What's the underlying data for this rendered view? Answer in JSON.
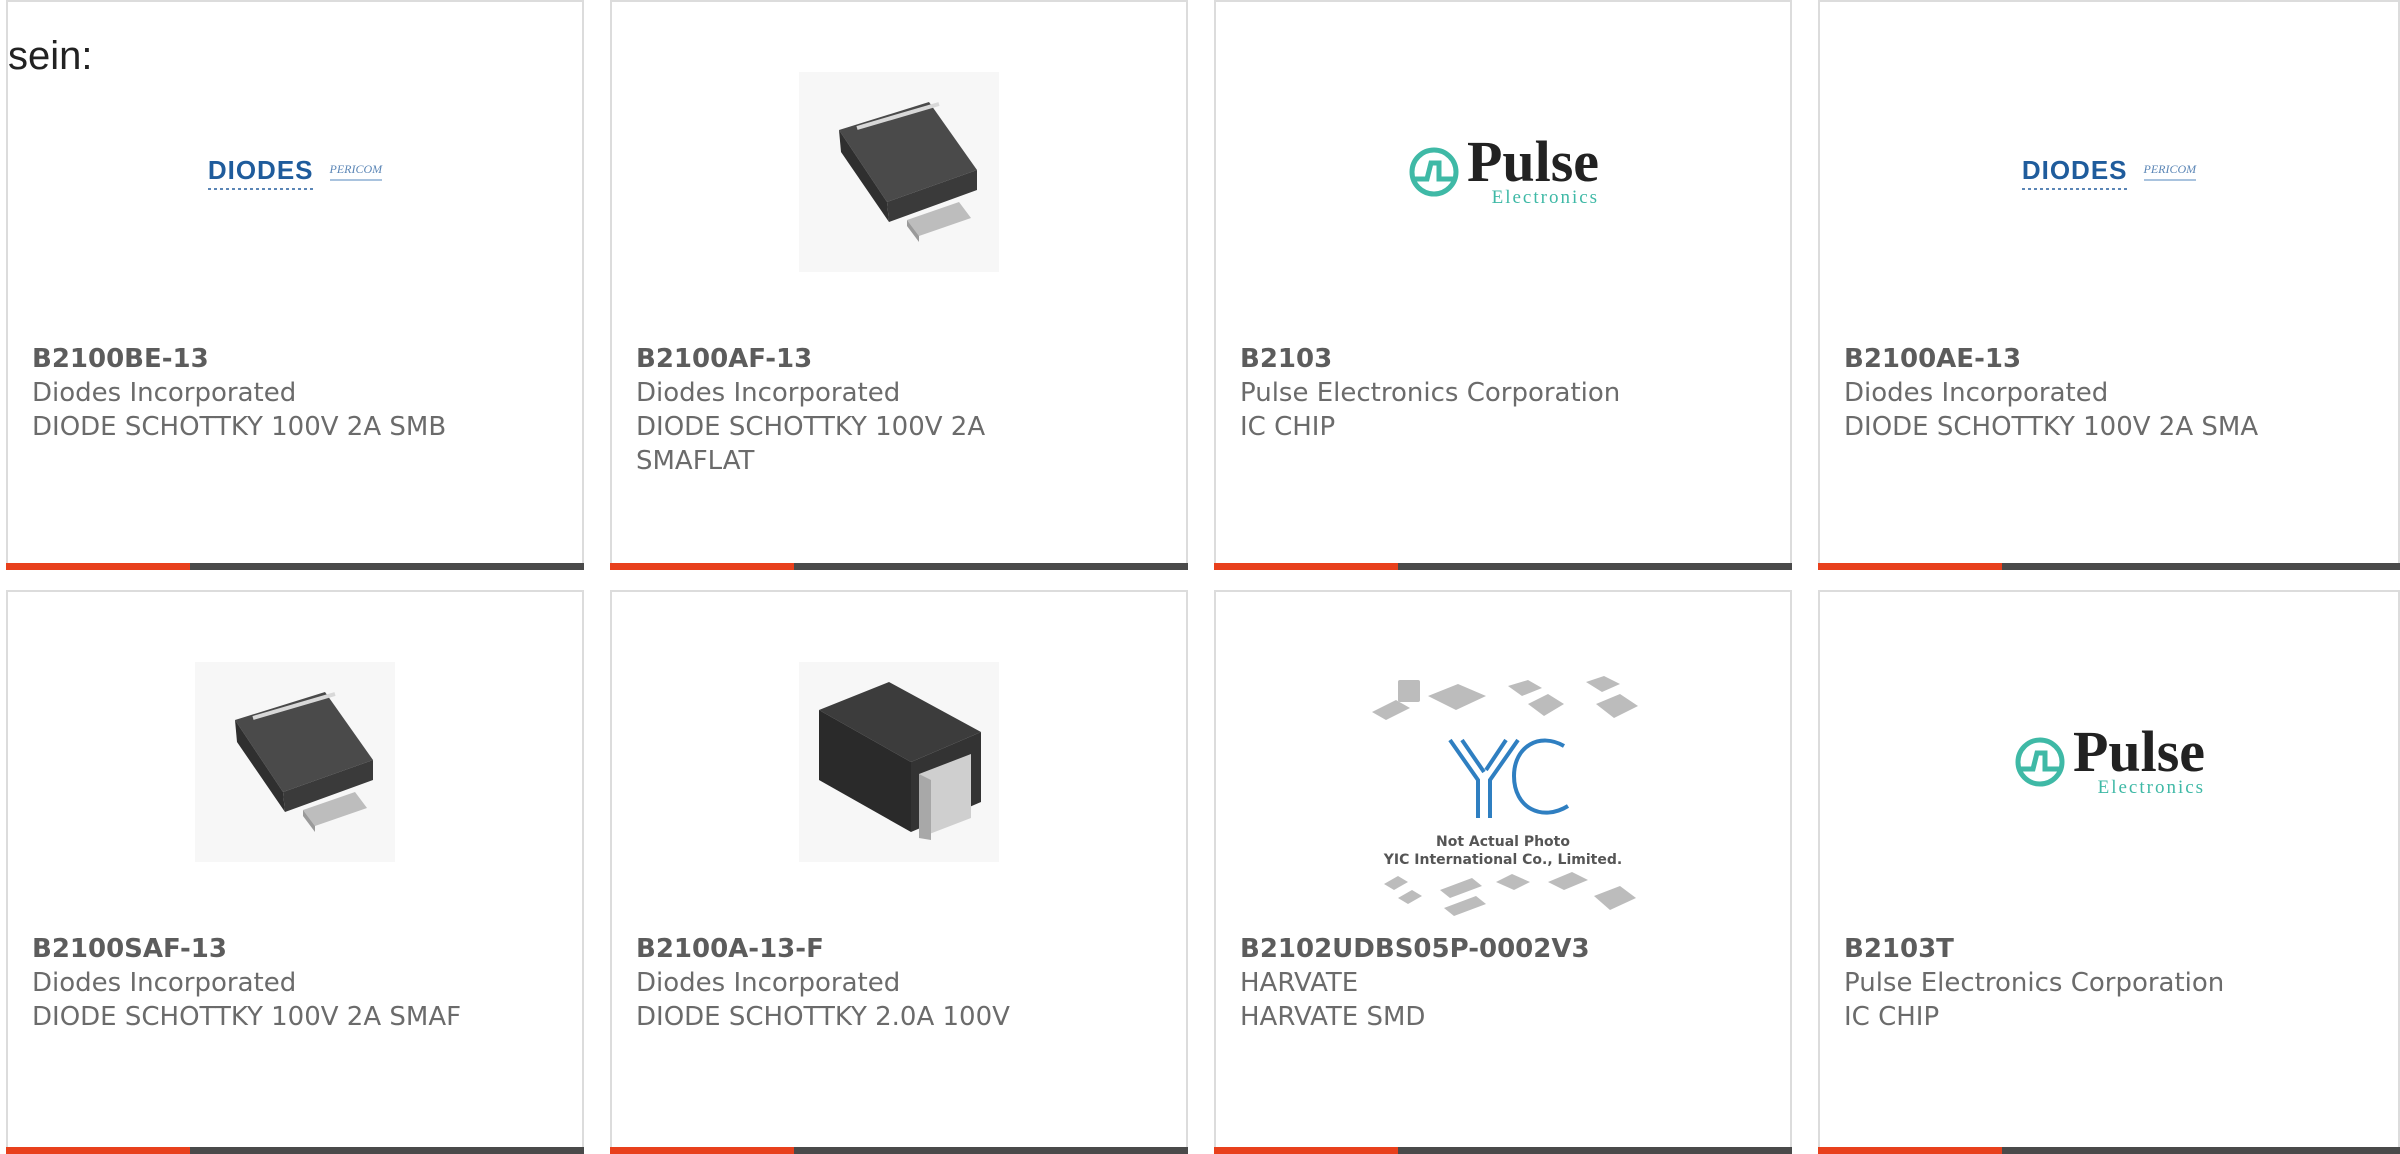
{
  "intro_text": "sein:",
  "products": [
    {
      "part_number": "B2100BE-13",
      "manufacturer": "Diodes Incorporated",
      "description": "DIODE SCHOTTKY 100V 2A SMB",
      "image": "diodes-pericom-logo"
    },
    {
      "part_number": "B2100AF-13",
      "manufacturer": "Diodes Incorporated",
      "description": "DIODE SCHOTTKY 100V 2A SMAFLAT",
      "image": "smd-diode-package-photo"
    },
    {
      "part_number": "B2103",
      "manufacturer": "Pulse Electronics Corporation",
      "description": "IC CHIP",
      "image": "pulse-electronics-logo"
    },
    {
      "part_number": "B2100AE-13",
      "manufacturer": "Diodes Incorporated",
      "description": "DIODE SCHOTTKY 100V 2A SMA",
      "image": "diodes-pericom-logo"
    },
    {
      "part_number": "B2100SAF-13",
      "manufacturer": "Diodes Incorporated",
      "description": "DIODE SCHOTTKY 100V 2A SMAF",
      "image": "smd-diode-package-photo"
    },
    {
      "part_number": "B2100A-13-F",
      "manufacturer": "Diodes Incorporated",
      "description": "DIODE SCHOTTKY 2.0A 100V",
      "image": "smb-diode-package-photo"
    },
    {
      "part_number": "B2102UDBS05P-0002V3",
      "manufacturer": "HARVATE",
      "description": "HARVATE SMD",
      "image": "yic-placeholder"
    },
    {
      "part_number": "B2103T",
      "manufacturer": "Pulse Electronics Corporation",
      "description": "IC CHIP",
      "image": "pulse-electronics-logo"
    }
  ],
  "logos": {
    "diodes_word": "DIODES",
    "diodes_sub": "PERICOM",
    "pulse_main": "Pulse",
    "pulse_sub": "Electronics",
    "yic_caption_1": "Not Actual Photo",
    "yic_caption_2": "YIC International Co., Limited."
  },
  "colors": {
    "accent": "#e8401c",
    "bar": "#4a4a4a",
    "diodes_blue": "#1f5c9c",
    "pulse_teal": "#3fb9a6"
  }
}
